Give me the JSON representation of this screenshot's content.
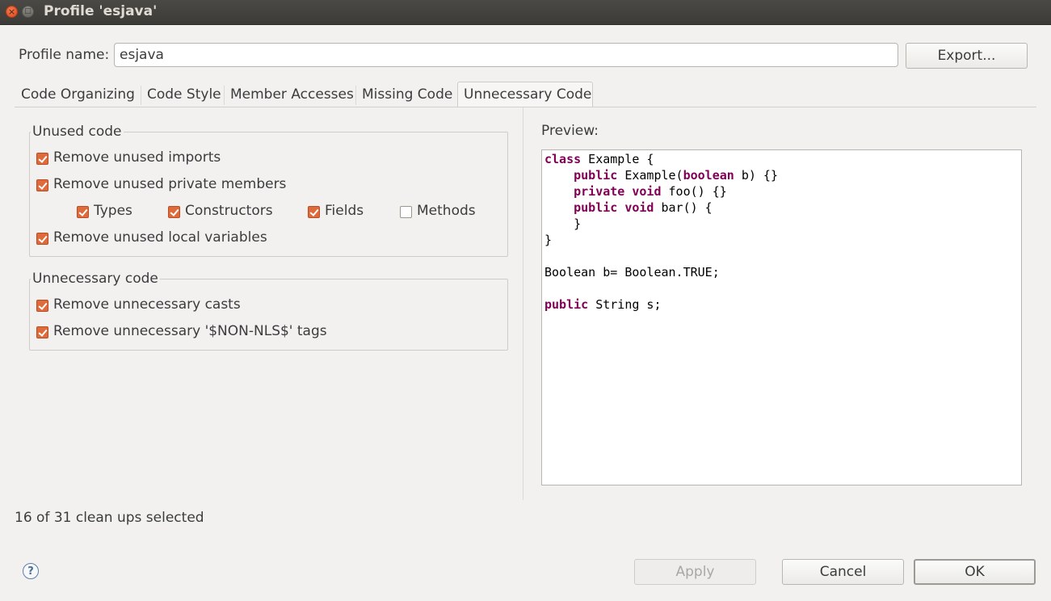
{
  "window": {
    "title": "Profile 'esjava'",
    "close_glyph": "×",
    "maximize_glyph": "□"
  },
  "profile": {
    "label": "Profile name:",
    "value": "esjava",
    "export_label": "Export..."
  },
  "tabs": [
    {
      "label": "Code Organizing",
      "active": false
    },
    {
      "label": "Code Style",
      "active": false
    },
    {
      "label": "Member Accesses",
      "active": false
    },
    {
      "label": "Missing Code",
      "active": false
    },
    {
      "label": "Unnecessary Code",
      "active": true
    }
  ],
  "unused_code": {
    "title": "Unused code",
    "remove_unused_imports": {
      "label": "Remove unused imports",
      "checked": true
    },
    "remove_unused_private_members": {
      "label": "Remove unused private members",
      "checked": true
    },
    "types": {
      "label": "Types",
      "checked": true
    },
    "constructors": {
      "label": "Constructors",
      "checked": true
    },
    "fields": {
      "label": "Fields",
      "checked": true
    },
    "methods": {
      "label": "Methods",
      "checked": false
    },
    "remove_unused_local_variables": {
      "label": "Remove unused local variables",
      "checked": true
    }
  },
  "unnecessary_code": {
    "title": "Unnecessary code",
    "remove_unnecessary_casts": {
      "label": "Remove unnecessary casts",
      "checked": true
    },
    "remove_unnecessary_nls_tags": {
      "label": "Remove unnecessary '$NON-NLS$' tags",
      "checked": true
    }
  },
  "preview": {
    "label": "Preview:",
    "lines": [
      [
        {
          "t": "class",
          "k": true
        },
        {
          "t": " Example {",
          "k": false
        }
      ],
      [
        {
          "t": "    ",
          "k": false
        },
        {
          "t": "public",
          "k": true
        },
        {
          "t": " Example(",
          "k": false
        },
        {
          "t": "boolean",
          "k": true
        },
        {
          "t": " b) {}",
          "k": false
        }
      ],
      [
        {
          "t": "    ",
          "k": false
        },
        {
          "t": "private",
          "k": true
        },
        {
          "t": " ",
          "k": false
        },
        {
          "t": "void",
          "k": true
        },
        {
          "t": " foo() {}",
          "k": false
        }
      ],
      [
        {
          "t": "    ",
          "k": false
        },
        {
          "t": "public",
          "k": true
        },
        {
          "t": " ",
          "k": false
        },
        {
          "t": "void",
          "k": true
        },
        {
          "t": " bar() {",
          "k": false
        }
      ],
      [
        {
          "t": "    }",
          "k": false
        }
      ],
      [
        {
          "t": "}",
          "k": false
        }
      ],
      [
        {
          "t": "",
          "k": false
        }
      ],
      [
        {
          "t": "Boolean b= Boolean.TRUE;",
          "k": false
        }
      ],
      [
        {
          "t": "",
          "k": false
        }
      ],
      [
        {
          "t": "public",
          "k": true
        },
        {
          "t": " String s;",
          "k": false
        }
      ]
    ]
  },
  "status": {
    "text": "16 of 31 clean ups selected"
  },
  "buttons": {
    "help_glyph": "?",
    "apply": "Apply",
    "cancel": "Cancel",
    "ok": "OK"
  }
}
